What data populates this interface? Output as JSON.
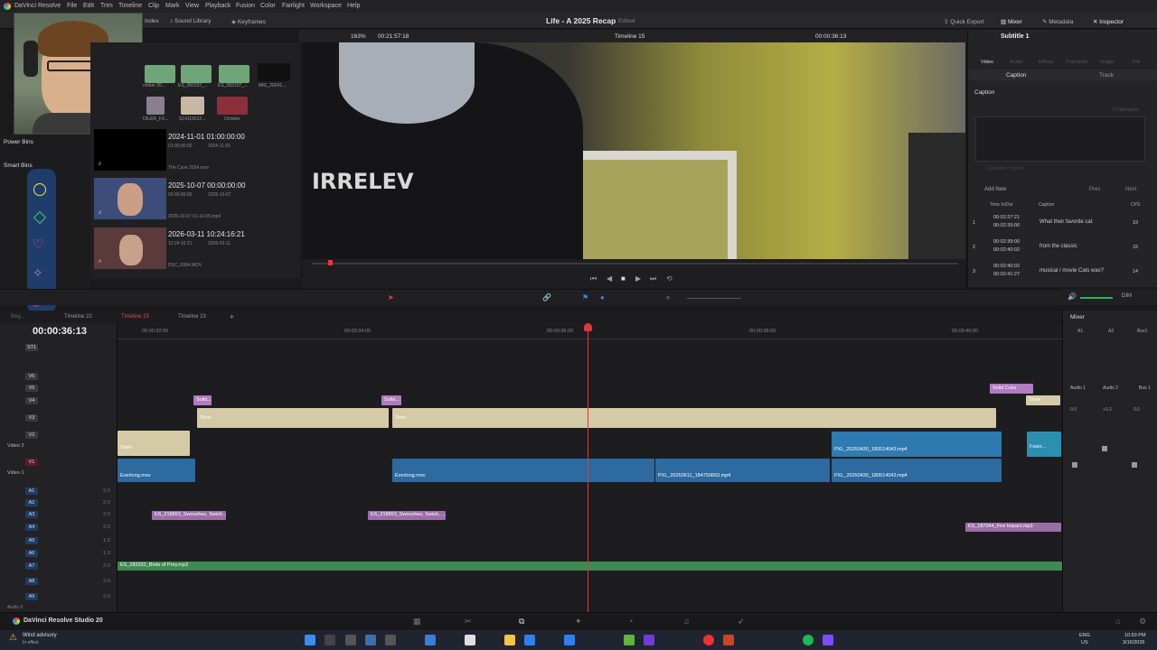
{
  "menubar": {
    "app_name": "DaVinci Resolve",
    "items": [
      "File",
      "Edit",
      "Trim",
      "Timeline",
      "Clip",
      "Mark",
      "View",
      "Playback",
      "Fusion",
      "Color",
      "Fairlight",
      "Workspace",
      "Help"
    ],
    "project_title": "Life - A 2025 Recap",
    "project_status": "Edited",
    "right_tools": [
      "Quick Export",
      "Mixer",
      "Metadata",
      "Inspector"
    ]
  },
  "toolbar": {
    "left_tabs": [
      "Index",
      "Sound Library",
      "Keyframes"
    ],
    "zoom": "163%",
    "source_timecode": "00:21:57:18",
    "timeline_name": "Timeline 15",
    "record_timecode": "00:00:36:13",
    "inspector_title": "Subtitle 1"
  },
  "media_pool": {
    "top_thumb_labels": [
      "ctober 20...",
      "ES_283107_...",
      "ES_283107_...",
      "IMG_20241..."
    ],
    "second_thumb_labels": [
      "OILER_FX...",
      "S14115612...",
      "October"
    ],
    "items": [
      {
        "title": "2024-11-01  01:00:00:00",
        "start": "01:00:00:00",
        "date": "2024-11-01",
        "file": "The Cave 2024.mov"
      },
      {
        "title": "2025-10-07  00:00:00:00",
        "start": "00:00:00:00",
        "date": "2025-10-07",
        "file": "2025-10-07 01-16-55.mp4"
      },
      {
        "title": "2026-03-11  10:24:16:21",
        "start": "10:24:16:21",
        "date": "2026-03-11",
        "file": "DSC_0994.MOV"
      }
    ]
  },
  "bins": {
    "power_bins": "Power Bins",
    "smart_bins": "Smart Bins",
    "sidebar_icons": [
      "circle-icon",
      "diamond-icon",
      "heart-icon",
      "sparkle-icon",
      "eye-icon"
    ]
  },
  "viewer": {
    "shirt_text": "IRRELEV"
  },
  "inspector": {
    "tabs": [
      "Video",
      "Audio",
      "Effects",
      "Transition",
      "Image",
      "File"
    ],
    "subtabs": [
      "Caption",
      "Track"
    ],
    "caption_label": "Caption",
    "characters": "0 Characters",
    "customize": "Customize Caption",
    "add_new": "Add New",
    "prev": "Prev",
    "next": "Next",
    "table_headers": [
      "Time In/Dur",
      "Caption",
      "CPS"
    ],
    "rows": [
      {
        "num": "1",
        "in": "00:02:37:21",
        "out": "00:02:39:00",
        "caption": "What their favorite cat",
        "cps": "19"
      },
      {
        "num": "2",
        "in": "00:02:39:00",
        "out": "00:02:40:02",
        "caption": "from the classic",
        "cps": "15"
      },
      {
        "num": "3",
        "in": "00:02:40:02",
        "out": "00:02:41:27",
        "caption": "musical / movie Cats was?",
        "cps": "14"
      }
    ]
  },
  "timeline": {
    "timecode": "00:00:36:13",
    "tabs": [
      "Beg...",
      "Timeline 22",
      "Timeline 15",
      "Timeline 23"
    ],
    "ruler": [
      "00:00:32:00",
      "00:00:34:00",
      "00:00:36:00",
      "00:00:38:00",
      "00:00:40:00"
    ],
    "video_tracks": [
      "ST1",
      "V6",
      "V5",
      "V4",
      "V3",
      "V2",
      "V1"
    ],
    "track_names": {
      "v2": "Video 2",
      "v1": "Video 1"
    },
    "audio_tracks": [
      {
        "id": "A1",
        "level": "2.0"
      },
      {
        "id": "A2",
        "level": "2.0"
      },
      {
        "id": "A3",
        "level": "2.0"
      },
      {
        "id": "A4",
        "level": "2.0"
      },
      {
        "id": "A5",
        "level": "1.0"
      },
      {
        "id": "A6",
        "level": "1.0"
      },
      {
        "id": "A7",
        "level": "2.0"
      },
      {
        "id": "A8",
        "level": "2.0"
      },
      {
        "id": "A9",
        "level": "2.0"
      }
    ],
    "audio_9": "Audio 9",
    "clips": {
      "solid1": "Solid...",
      "solid2": "Solid...",
      "solid_color": "Solid Color",
      "text1": "Text+",
      "text2": "Text+",
      "text3": "Text+",
      "text4": "Text+",
      "fusion": "Fusio...",
      "pxl_top": "PXL_20250430_180514043.mp4",
      "v1_a": "Everlong.mov",
      "v1_b": "Everlong.mov",
      "v1_c": "PXL_20250611_184750663.mp4",
      "v1_d": "PXL_20250430_180514043.mp4",
      "a3_a": "ES_218893_Swooshes, Swish...",
      "a3_b": "ES_218893_Swooshes, Swish, ...",
      "a4": "ES_187044_Fire Impact.mp3",
      "a7": "ES_283332_Birds of Prey.mp3"
    }
  },
  "mixer": {
    "title": "Mixer",
    "dim": "DIM",
    "cols": [
      "A1",
      "A2",
      "Bus1"
    ],
    "strips": [
      "Audio 1",
      "Audio 2",
      "Bus 1"
    ],
    "vals": [
      "0.0",
      "+3.2",
      "0.0"
    ]
  },
  "footer": {
    "app_label": "DaVinci Resolve Studio 20",
    "weather_title": "Wind advisory",
    "weather_sub": "In effect",
    "lang": "ENG",
    "region": "US",
    "time": "10:59 PM",
    "date": "3/16/2026"
  }
}
